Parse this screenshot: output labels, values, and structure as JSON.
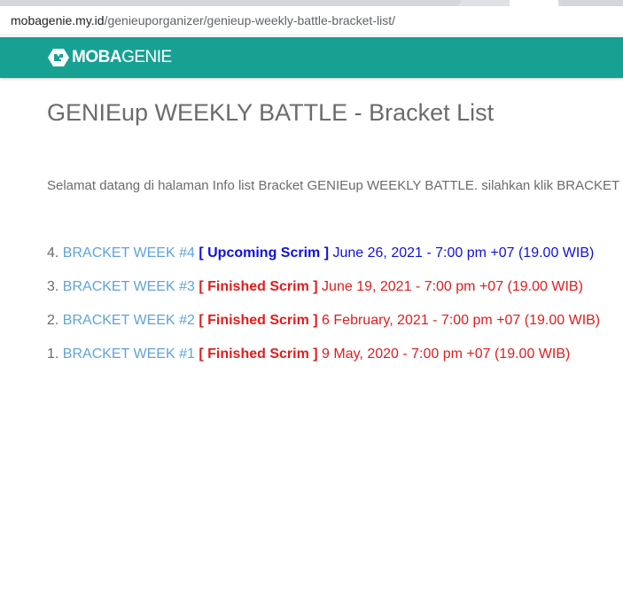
{
  "browser": {
    "url_host": "mobagenie.my.id",
    "url_path": "/genieuporganizer/genieup-weekly-battle-bracket-list/"
  },
  "header": {
    "brand_bold": "MOBA",
    "brand_light": "GENIE",
    "bg_color": "#17a193"
  },
  "page": {
    "title": "GENIEup WEEKLY BATTLE - Bracket List",
    "intro": "Selamat datang di halaman Info list Bracket GENIEup WEEKLY BATTLE. silahkan klik BRACKET"
  },
  "brackets": [
    {
      "num": "4.",
      "link": "BRACKET WEEK #4",
      "badge": "[ Upcoming Scrim ]",
      "status": "upcoming",
      "date": "June 26, 2021 - 7:00 pm +07 (19.00 WIB)"
    },
    {
      "num": "3.",
      "link": "BRACKET WEEK #3",
      "badge": "[ Finished Scrim ]",
      "status": "finished",
      "date": "June 19, 2021 - 7:00 pm +07 (19.00 WIB)"
    },
    {
      "num": "2.",
      "link": "BRACKET WEEK #2",
      "badge": "[ Finished Scrim ]",
      "status": "finished",
      "date": "6 February, 2021 - 7:00 pm +07 (19.00 WIB)"
    },
    {
      "num": "1.",
      "link": "BRACKET WEEK #1",
      "badge": "[ Finished Scrim ]",
      "status": "finished",
      "date": "9 May, 2020 - 7:00 pm +07 (19.00 WIB)"
    }
  ],
  "colors": {
    "link": "#5ea4d8",
    "upcoming": "#1010e0",
    "finished": "#e21c1c",
    "text": "#6b6b6b"
  }
}
